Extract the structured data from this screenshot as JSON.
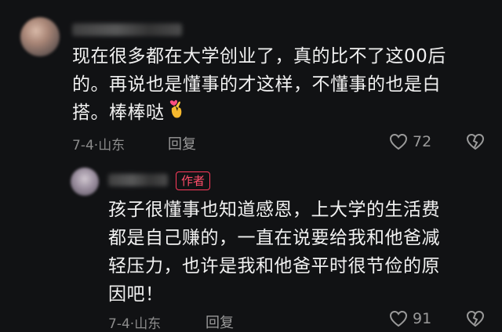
{
  "comments": [
    {
      "text_lines": [
        "现在很多都在大学创业了，真的比不了这00后",
        "的。再说也是懂事的才这样，不懂事的也是白",
        "搭。棒棒哒"
      ],
      "date": "7-4",
      "location": "山东",
      "reply_label": "回复",
      "likes": "72",
      "emoji": "finger-heart-icon"
    },
    {
      "badge": "作者",
      "text_lines": [
        "孩子很懂事也知道感恩，上大学的生活费",
        "都是自己赚的，一直在说要给我和他爸减",
        "轻压力，也许是我和他爸平时很节俭的原",
        "因吧！"
      ],
      "date": "7-4",
      "location": "山东",
      "reply_label": "回复",
      "likes": "91"
    }
  ],
  "colors": {
    "background": "#111214",
    "badge": "#ff4d6a",
    "meta": "#8c8c8c"
  },
  "icons": [
    "heart-outline-icon",
    "broken-heart-icon"
  ]
}
